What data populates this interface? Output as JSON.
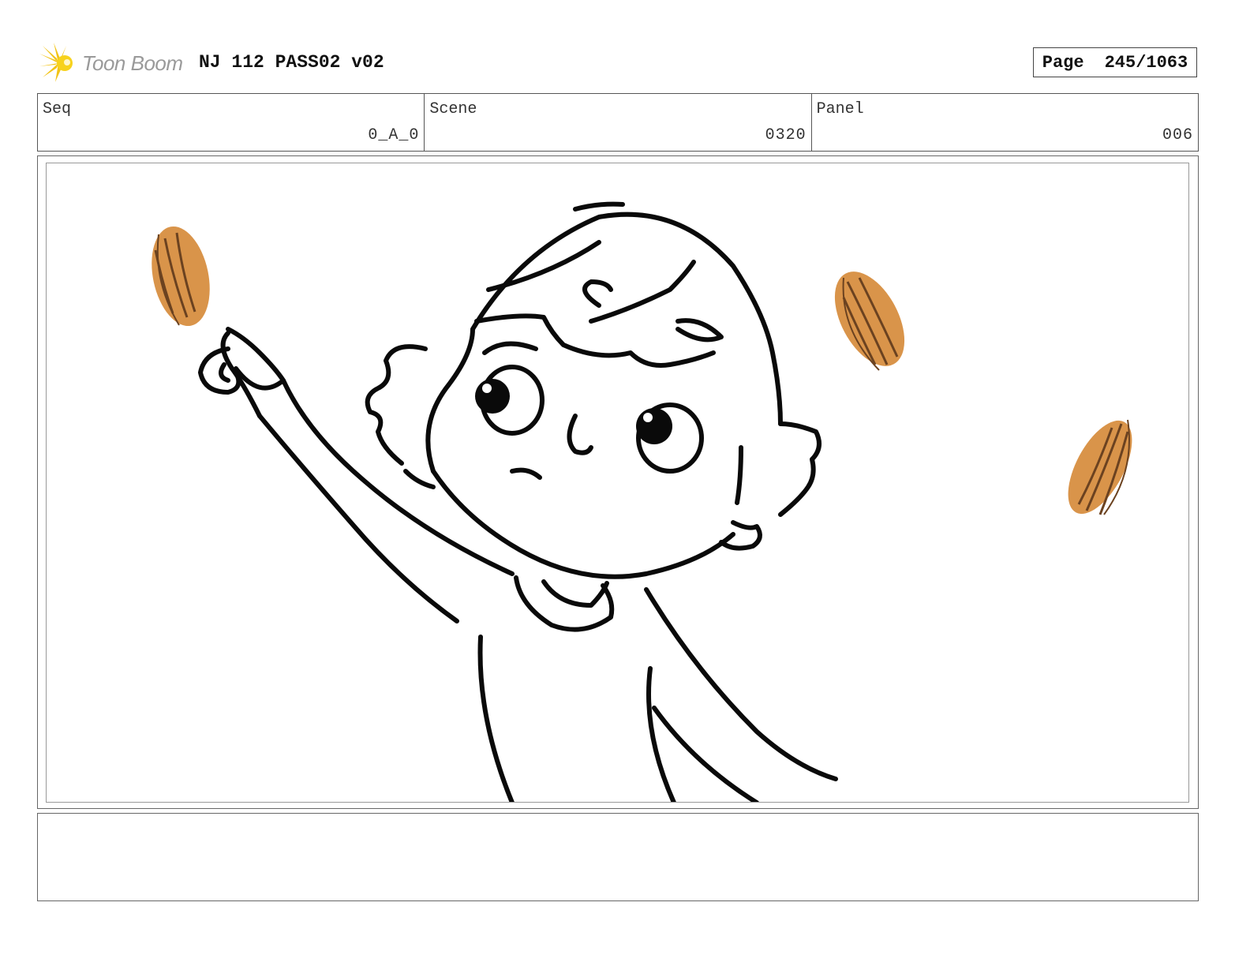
{
  "header": {
    "logo_text": "Toon Boom",
    "project_title": "NJ 112 PASS02 v02",
    "page_label": "Page",
    "page_number": "245/1063"
  },
  "info": {
    "seq_label": "Seq",
    "seq_value": "0_A_0",
    "scene_label": "Scene",
    "scene_value": "0320",
    "panel_label": "Panel",
    "panel_value": "006"
  },
  "panel": {
    "image_icon": "storyboard-drawing",
    "accent_color": "#d9944a"
  },
  "notes": {
    "text": ""
  }
}
